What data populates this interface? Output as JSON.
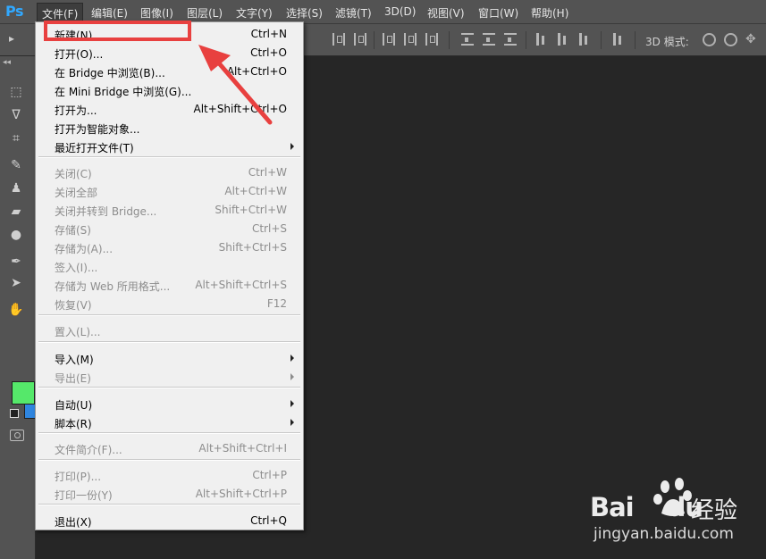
{
  "app": {
    "logo_text": "Ps"
  },
  "menubar": {
    "items": [
      "文件(F)",
      "编辑(E)",
      "图像(I)",
      "图层(L)",
      "文字(Y)",
      "选择(S)",
      "滤镜(T)",
      "3D(D)",
      "视图(V)",
      "窗口(W)",
      "帮助(H)"
    ],
    "active_index": 0
  },
  "optionsbar": {
    "mode3d_label": "3D 模式:"
  },
  "toolpanel": {
    "collapse_glyph": "◂◂",
    "foreground_color": "#55e86a",
    "background_color": "#2f86e0"
  },
  "file_menu": {
    "items": [
      {
        "label": "新建(N)...",
        "shortcut": "Ctrl+N",
        "disabled": false,
        "submenu": false
      },
      {
        "label": "打开(O)...",
        "shortcut": "Ctrl+O",
        "disabled": false,
        "submenu": false
      },
      {
        "label": "在 Bridge 中浏览(B)...",
        "shortcut": "Alt+Ctrl+O",
        "disabled": false,
        "submenu": false
      },
      {
        "label": "在 Mini Bridge 中浏览(G)...",
        "shortcut": "",
        "disabled": false,
        "submenu": false
      },
      {
        "label": "打开为...",
        "shortcut": "Alt+Shift+Ctrl+O",
        "disabled": false,
        "submenu": false
      },
      {
        "label": "打开为智能对象...",
        "shortcut": "",
        "disabled": false,
        "submenu": false
      },
      {
        "label": "最近打开文件(T)",
        "shortcut": "",
        "disabled": false,
        "submenu": true
      },
      {
        "label": "关闭(C)",
        "shortcut": "Ctrl+W",
        "disabled": true,
        "submenu": false
      },
      {
        "label": "关闭全部",
        "shortcut": "Alt+Ctrl+W",
        "disabled": true,
        "submenu": false
      },
      {
        "label": "关闭并转到 Bridge...",
        "shortcut": "Shift+Ctrl+W",
        "disabled": true,
        "submenu": false
      },
      {
        "label": "存储(S)",
        "shortcut": "Ctrl+S",
        "disabled": true,
        "submenu": false
      },
      {
        "label": "存储为(A)...",
        "shortcut": "Shift+Ctrl+S",
        "disabled": true,
        "submenu": false
      },
      {
        "label": "签入(I)...",
        "shortcut": "",
        "disabled": true,
        "submenu": false
      },
      {
        "label": "存储为 Web 所用格式...",
        "shortcut": "Alt+Shift+Ctrl+S",
        "disabled": true,
        "submenu": false
      },
      {
        "label": "恢复(V)",
        "shortcut": "F12",
        "disabled": true,
        "submenu": false
      },
      {
        "label": "置入(L)...",
        "shortcut": "",
        "disabled": true,
        "submenu": false
      },
      {
        "label": "导入(M)",
        "shortcut": "",
        "disabled": false,
        "submenu": true
      },
      {
        "label": "导出(E)",
        "shortcut": "",
        "disabled": true,
        "submenu": true
      },
      {
        "label": "自动(U)",
        "shortcut": "",
        "disabled": false,
        "submenu": true
      },
      {
        "label": "脚本(R)",
        "shortcut": "",
        "disabled": false,
        "submenu": true
      },
      {
        "label": "文件简介(F)...",
        "shortcut": "Alt+Shift+Ctrl+I",
        "disabled": true,
        "submenu": false
      },
      {
        "label": "打印(P)...",
        "shortcut": "Ctrl+P",
        "disabled": true,
        "submenu": false
      },
      {
        "label": "打印一份(Y)",
        "shortcut": "Alt+Shift+Ctrl+P",
        "disabled": true,
        "submenu": false
      },
      {
        "label": "退出(X)",
        "shortcut": "Ctrl+Q",
        "disabled": false,
        "submenu": false
      }
    ]
  },
  "annotation": {
    "color": "#e8403f"
  },
  "watermark": {
    "logo_text": "Bai",
    "logo_suffix": "du",
    "product": "经验",
    "url": "jingyan.baidu.com"
  }
}
